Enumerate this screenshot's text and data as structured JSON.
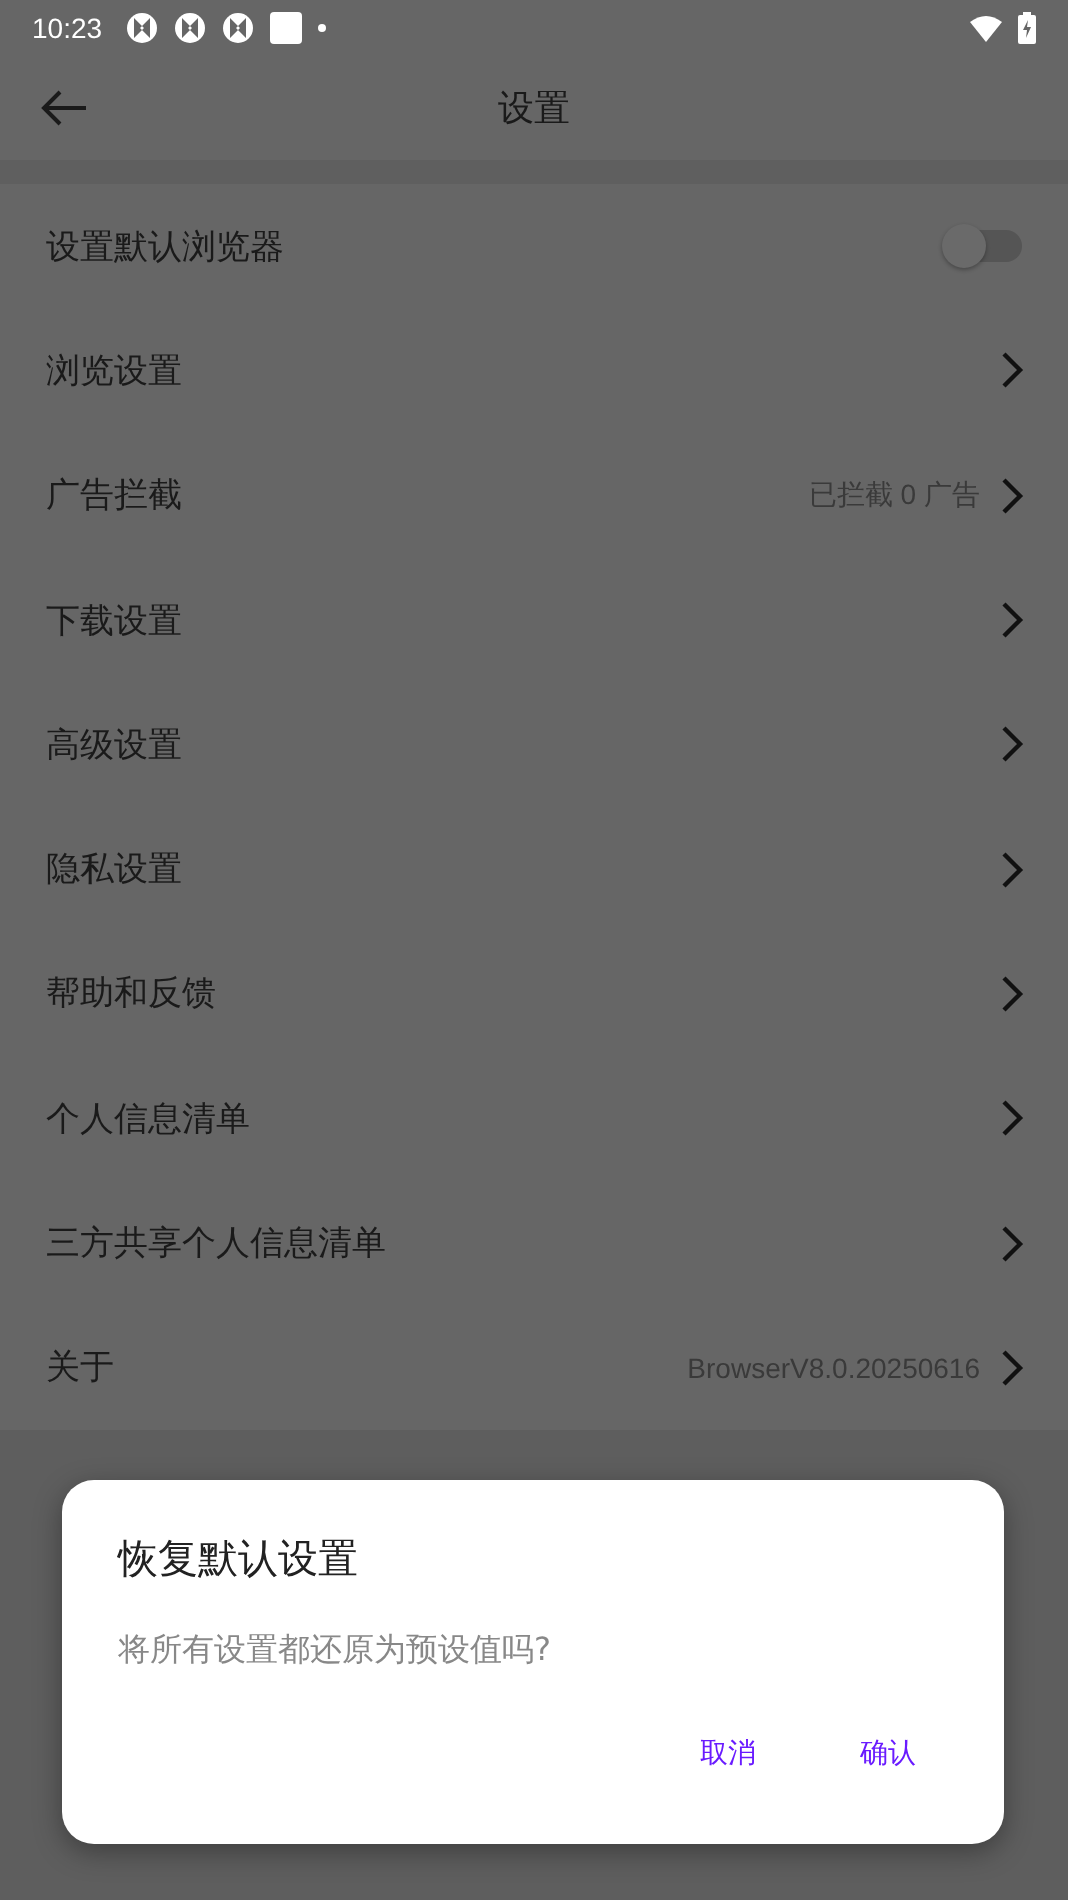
{
  "status_bar": {
    "time": "10:23"
  },
  "header": {
    "title": "设置"
  },
  "settings": [
    {
      "kind": "toggle",
      "label": "设置默认浏览器",
      "on": false
    },
    {
      "kind": "link",
      "label": "浏览设置"
    },
    {
      "kind": "link",
      "label": "广告拦截",
      "detail": "已拦截 0 广告"
    },
    {
      "kind": "link",
      "label": "下载设置"
    },
    {
      "kind": "link",
      "label": "高级设置"
    },
    {
      "kind": "link",
      "label": "隐私设置"
    },
    {
      "kind": "link",
      "label": "帮助和反馈"
    },
    {
      "kind": "link",
      "label": "个人信息清单"
    },
    {
      "kind": "link",
      "label": "三方共享个人信息清单"
    },
    {
      "kind": "link",
      "label": "关于",
      "detail": "BrowserV8.0.20250616"
    }
  ],
  "dialog": {
    "title": "恢复默认设置",
    "message": "将所有设置都还原为预设值吗?",
    "buttons": [
      "取消",
      "确认"
    ]
  }
}
